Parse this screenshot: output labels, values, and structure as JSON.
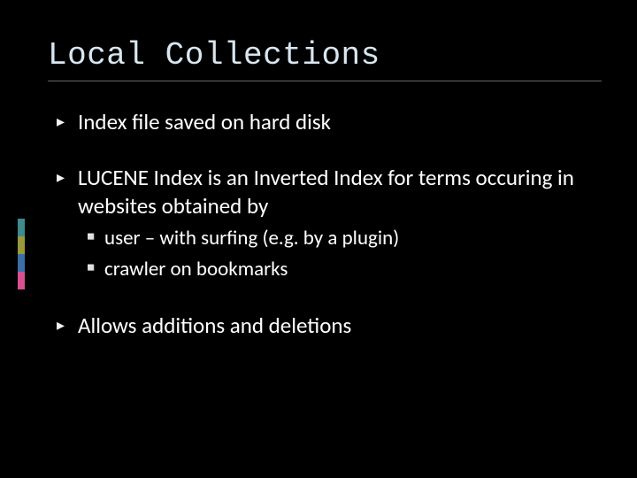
{
  "slide": {
    "title": "Local Collections",
    "bullets": [
      {
        "text": "Index file saved on hard disk"
      },
      {
        "text": "LUCENE Index is an Inverted Index for terms occuring in websites obtained by",
        "sub": [
          {
            "text": "user – with surfing (e.g. by a plugin)"
          },
          {
            "text": "crawler on bookmarks"
          }
        ]
      },
      {
        "text": "Allows additions and deletions"
      }
    ]
  },
  "accent_colors": [
    "#3e8a8c",
    "#9a9a3a",
    "#3a6fa8",
    "#d94f8f"
  ]
}
